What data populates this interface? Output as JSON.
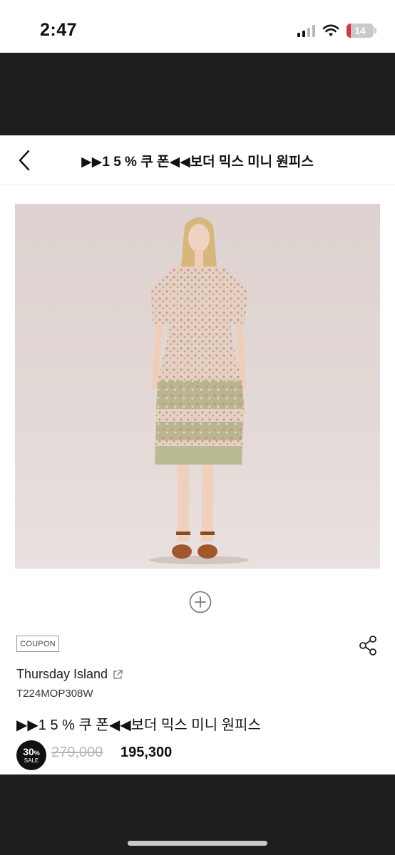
{
  "status_bar": {
    "time": "2:47",
    "battery": "14"
  },
  "nav": {
    "title": "▶▶1 5 % 쿠 폰◀◀보더 믹스 미니 원피스"
  },
  "product": {
    "coupon_label": "COUPON",
    "brand": "Thursday Island",
    "code": "T224MOP308W",
    "name": "▶▶1 5 % 쿠 폰◀◀보더 믹스 미니 원피스",
    "discount": "30",
    "discount_unit": "%",
    "sale_label": "SALE",
    "original_price": "279,000",
    "current_price": "195,300"
  },
  "icons": {
    "back": "chevron-left-icon",
    "zoom": "plus-circle-icon",
    "share": "share-icon",
    "external": "external-link-icon"
  },
  "colors": {
    "bar_black": "#1e1e1e",
    "battery_low": "#e0303a",
    "strike_price": "#b5b5b5"
  }
}
